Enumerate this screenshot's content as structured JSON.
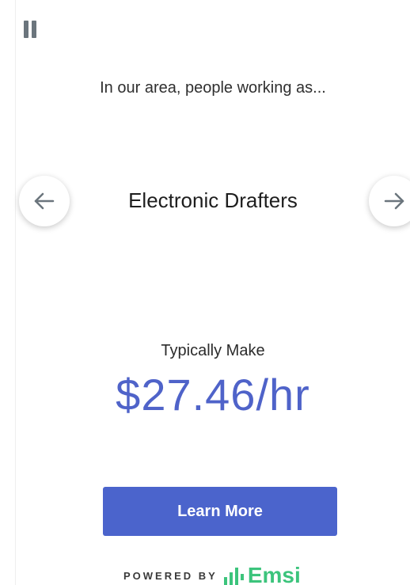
{
  "widget": {
    "intro_text": "In our area, people working as...",
    "occupation": "Electronic Drafters",
    "wage_label": "Typically Make",
    "wage_value": "$27.46/hr",
    "learn_more_label": "Learn More",
    "powered_by": "POWERED BY",
    "brand_name": "Emsi"
  },
  "colors": {
    "accent": "#4b64cc",
    "wage_text": "#4f63c9",
    "brand_green": "#3cc47c",
    "icon_gray": "#6b757d"
  },
  "icons": {
    "pause": "pause-icon",
    "prev": "arrow-left-icon",
    "next": "arrow-right-icon",
    "brand": "emsi-bars-icon"
  }
}
